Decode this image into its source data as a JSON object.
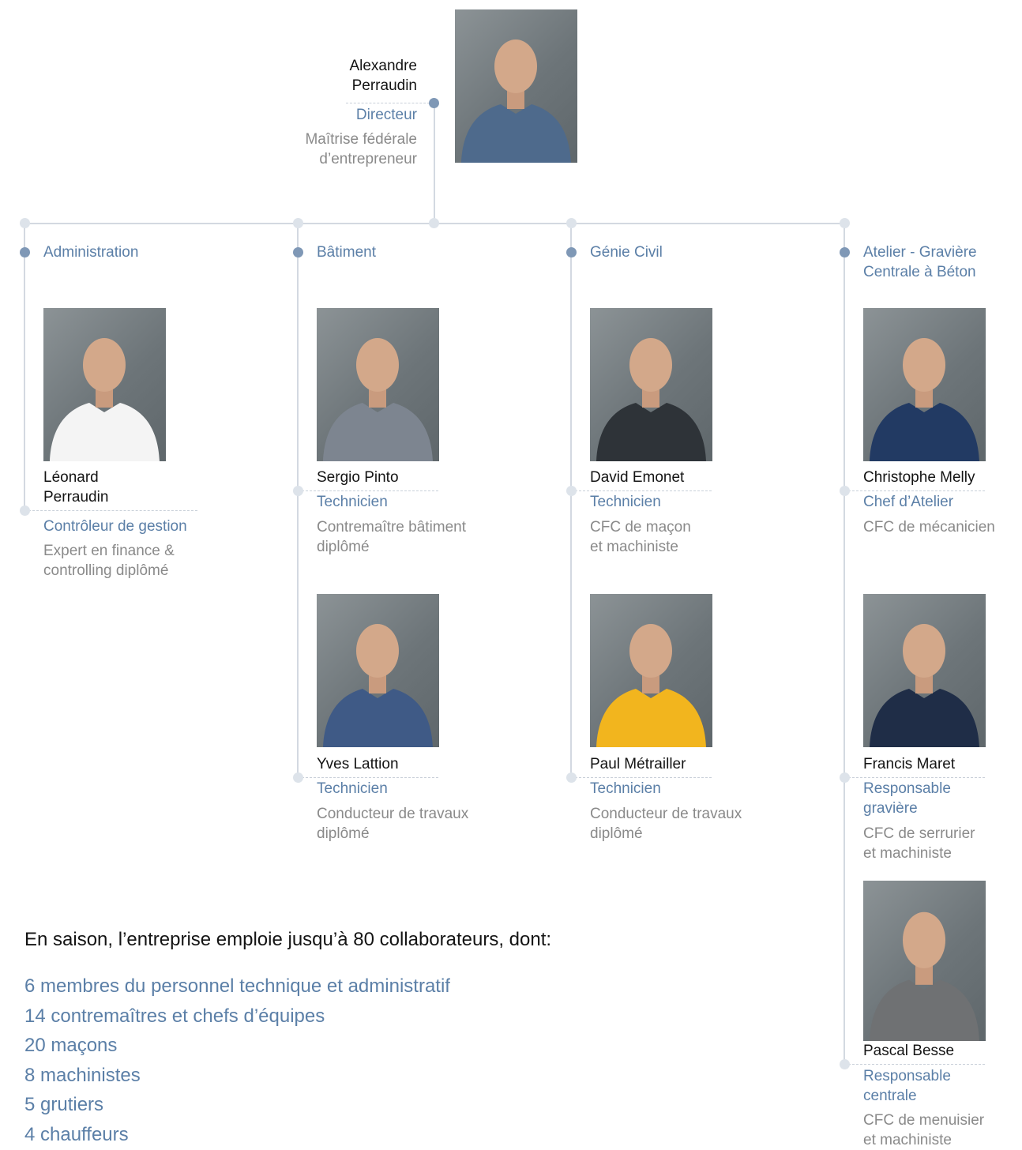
{
  "director": {
    "name": "Alexandre\nPerraudin",
    "role": "Directeur",
    "qualification": "Maîtrise fédérale\nd’entrepreneur",
    "shirt_color": "#4e6a8c"
  },
  "departments": [
    {
      "label": "Administration"
    },
    {
      "label": "Bâtiment"
    },
    {
      "label": "Génie Civil"
    },
    {
      "label": "Atelier - Gravière\nCentrale à Béton"
    }
  ],
  "people": [
    {
      "name": "Léonard\nPerraudin",
      "role": "Contrôleur de gestion",
      "qualification": "Expert en finance &\ncontrolling diplômé",
      "shirt_color": "#f4f4f4"
    },
    {
      "name": "Sergio Pinto",
      "role": "Technicien",
      "qualification": "Contremaître bâtiment\ndiplômé",
      "shirt_color": "#7d8590"
    },
    {
      "name": "Yves Lattion",
      "role": "Technicien",
      "qualification": "Conducteur de travaux\ndiplômé",
      "shirt_color": "#3f5a86"
    },
    {
      "name": "David Emonet",
      "role": "Technicien",
      "qualification": "CFC de maçon\net machiniste",
      "shirt_color": "#2e3338"
    },
    {
      "name": "Paul Métrailler",
      "role": "Technicien",
      "qualification": "Conducteur de travaux\ndiplômé",
      "shirt_color": "#f2b51e"
    },
    {
      "name": "Christophe Melly",
      "role": "Chef d’Atelier",
      "qualification": "CFC de mécanicien",
      "shirt_color": "#223a63"
    },
    {
      "name": "Francis Maret",
      "role": "Responsable\ngravière",
      "qualification": "CFC de serrurier\net machiniste",
      "shirt_color": "#1f2d47"
    },
    {
      "name": "Pascal Besse",
      "role": "Responsable\ncentrale",
      "qualification": "CFC de menuisier\net machiniste",
      "shirt_color": "#6f7173"
    }
  ],
  "summary": {
    "intro": "En saison, l’entreprise emploie jusqu’à 80 collaborateurs, dont:",
    "items": [
      "6 membres du personnel technique et administratif",
      "14 contremaîtres et chefs d’équipes",
      "20 maçons",
      "8 machinistes",
      "5 grutiers",
      "4 chauffeurs"
    ]
  },
  "colors": {
    "accent": "#5b7fa7",
    "name_text": "#141414",
    "muted_text": "#8a8a8a",
    "connector": "#d3d9e1",
    "dot_dark": "#7f98b6"
  }
}
